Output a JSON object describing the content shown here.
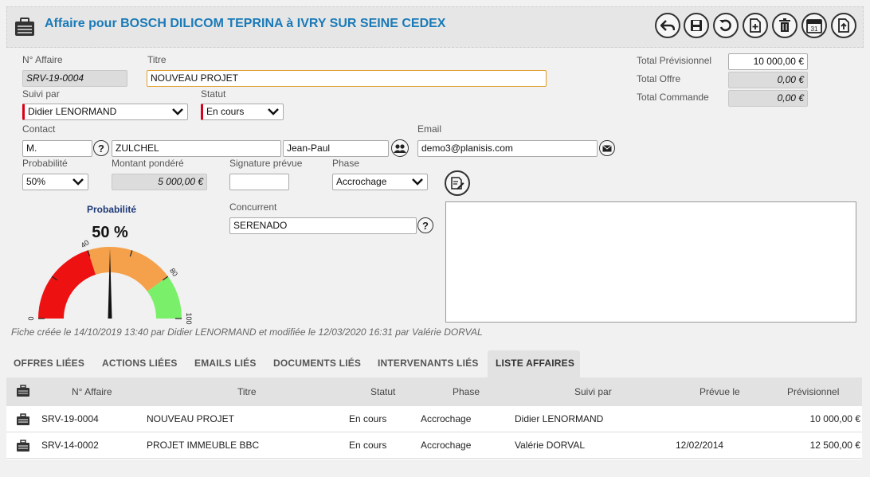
{
  "header": {
    "title": "Affaire pour BOSCH DILICOM TEPRINA à IVRY SUR SEINE CEDEX"
  },
  "toolbar": [
    "back-icon",
    "save-icon",
    "refresh-icon",
    "new-document-icon",
    "delete-icon",
    "calendar-icon",
    "export-icon"
  ],
  "calendar_day": "31",
  "form": {
    "num_label": "N° Affaire",
    "num_value": "SRV-19-0004",
    "titre_label": "Titre",
    "titre_value": "NOUVEAU PROJET",
    "suivi_label": "Suivi par",
    "suivi_value": "Didier LENORMAND",
    "statut_label": "Statut",
    "statut_value": "En cours",
    "contact_label": "Contact",
    "civilite": "M.",
    "nom": "ZULCHEL",
    "prenom": "Jean-Paul",
    "email_label": "Email",
    "email_value": "demo3@planisis.com",
    "proba_label": "Probabilité",
    "proba_value": "50%",
    "montant_label": "Montant pondéré",
    "montant_value": "5 000,00 €",
    "signature_label": "Signature prévue",
    "signature_value": "",
    "phase_label": "Phase",
    "phase_value": "Accrochage",
    "concurrent_label": "Concurrent",
    "concurrent_value": "SERENADO",
    "help_glyph": "?"
  },
  "totals": {
    "prev_label": "Total Prévisionnel",
    "prev_value": "10 000,00 €",
    "offre_label": "Total Offre",
    "offre_value": "0,00 €",
    "cmd_label": "Total Commande",
    "cmd_value": "0,00 €"
  },
  "gauge": {
    "title": "Probabilité",
    "value_text": "50 %",
    "value": 50,
    "ticks": [
      "0",
      "40",
      "80",
      "100"
    ],
    "colors": {
      "red": "#ee1111",
      "orange": "#f5a04a",
      "green": "#7af06a"
    }
  },
  "footer_note": "Fiche créée le 14/10/2019 13:40 par Didier LENORMAND et modifiée le 12/03/2020 16:31 par Valérie DORVAL",
  "tabs": [
    "OFFRES LIÉES",
    "ACTIONS LIÉES",
    "EMAILS LIÉS",
    "DOCUMENTS LIÉS",
    "INTERVENANTS LIÉS",
    "LISTE AFFAIRES"
  ],
  "active_tab": "LISTE AFFAIRES",
  "table": {
    "headers": [
      "N° Affaire",
      "Titre",
      "Statut",
      "Phase",
      "Suivi par",
      "Prévue le",
      "Prévisionnel"
    ],
    "rows": [
      [
        "SRV-19-0004",
        "NOUVEAU PROJET",
        "En cours",
        "Accrochage",
        "Didier LENORMAND",
        "",
        "10 000,00 €"
      ],
      [
        "SRV-14-0002",
        "PROJET IMMEUBLE BBC",
        "En cours",
        "Accrochage",
        "Valérie DORVAL",
        "12/02/2014",
        "12 500,00 €"
      ]
    ]
  }
}
